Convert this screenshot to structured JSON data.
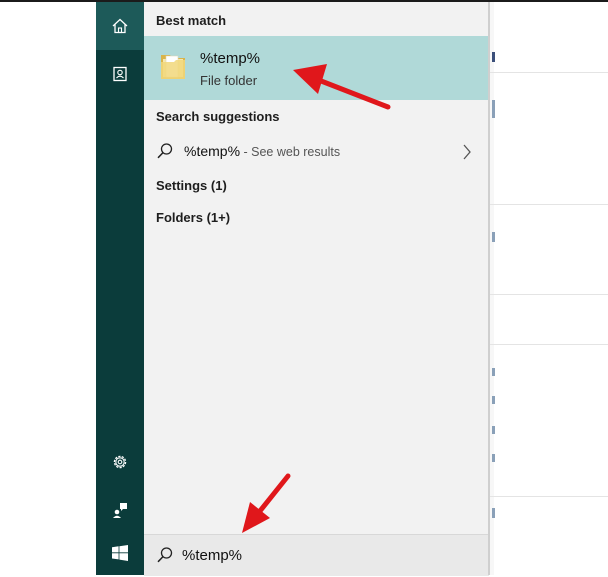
{
  "rail": {
    "items": [
      {
        "name": "home",
        "icon": "home-icon"
      },
      {
        "name": "documents",
        "icon": "document-icon"
      },
      {
        "name": "settings",
        "icon": "gear-icon"
      },
      {
        "name": "feedback",
        "icon": "feedback-icon"
      },
      {
        "name": "start",
        "icon": "windows-logo-icon"
      }
    ]
  },
  "results": {
    "best_match_title": "Best match",
    "best_match": {
      "name": "%temp%",
      "type": "File folder",
      "icon": "folder-icon"
    },
    "suggestions_title": "Search suggestions",
    "suggestion": {
      "query": "%temp%",
      "suffix": " - See web results"
    },
    "categories": [
      {
        "label": "Settings",
        "count": "(1)"
      },
      {
        "label": "Folders",
        "count": "(1+)"
      }
    ]
  },
  "search": {
    "value": "%temp%",
    "icon": "search-icon"
  },
  "colors": {
    "rail_bg": "#0b3c3b",
    "highlight": "#b0d9d8",
    "panel_bg": "#f2f2f2",
    "arrow": "#e0171b"
  }
}
